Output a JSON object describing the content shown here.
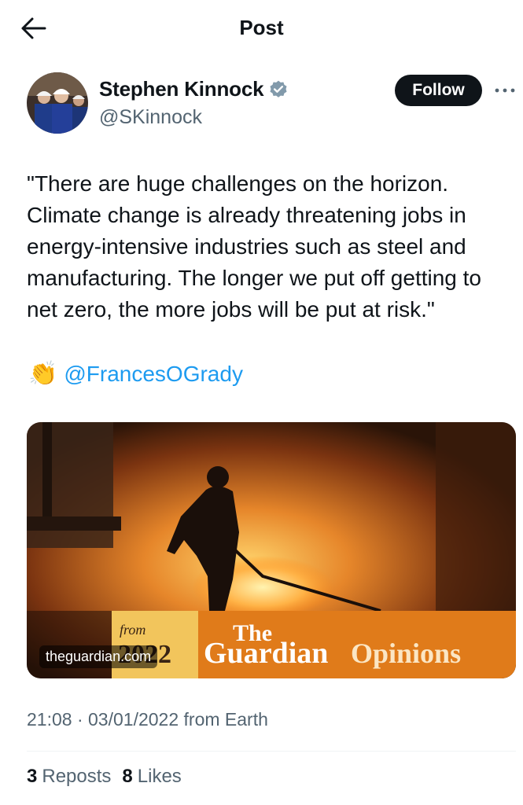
{
  "header": {
    "title": "Post",
    "back_icon": "arrow-left-icon"
  },
  "author": {
    "name": "Stephen Kinnock",
    "handle": "@SKinnock",
    "verified_icon": "verified-badge-icon",
    "verified_color": "#829aab"
  },
  "actions": {
    "follow_label": "Follow",
    "more_icon": "more-horizontal-icon"
  },
  "tweet": {
    "text": "\"There are huge challenges on the horizon. Climate change is already threatening jobs in energy-intensive industries such as steel and manufacturing. The longer we put off getting to net zero, the more jobs will be put at risk.\"",
    "clap_emoji": "👏",
    "mention": "@FrancesOGrady"
  },
  "card": {
    "domain": "theguardian.com",
    "banner_from": "from",
    "banner_year": "2022",
    "banner_brand_the": "The",
    "banner_brand_guardian": "Guardian",
    "banner_brand_opinions": "Opinions",
    "banner_color": "#e07b1a",
    "year_box_color": "#f2c55c"
  },
  "meta": {
    "time": "21:08",
    "separator": "·",
    "date": "03/01/2022",
    "source": "from Earth"
  },
  "stats": {
    "reposts_count": "3",
    "reposts_label": "Reposts",
    "likes_count": "8",
    "likes_label": "Likes"
  },
  "colors": {
    "text": "#0f1419",
    "secondary": "#536471",
    "link": "#1d9bf0"
  }
}
